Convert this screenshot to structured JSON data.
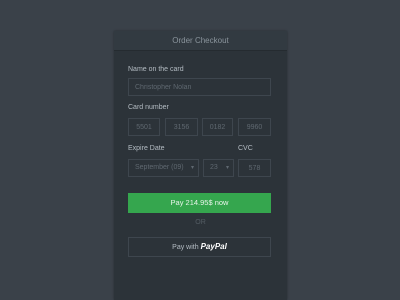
{
  "header": {
    "title": "Order Checkout"
  },
  "name_on_card": {
    "label": "Name on the card",
    "value": "Christopher Nolan"
  },
  "card_number": {
    "label": "Card number",
    "groups": [
      "5501",
      "3156",
      "0182",
      "9960"
    ]
  },
  "expire_date": {
    "label": "Expire Date",
    "month": "September (09)",
    "year": "23"
  },
  "cvc": {
    "label": "CVC",
    "value": "578"
  },
  "pay_button": {
    "label": "Pay 214.95$ now"
  },
  "separator": {
    "label": "OR"
  },
  "paypal_button": {
    "prefix": "Pay with",
    "brand": "PayPal"
  },
  "colors": {
    "accent": "#35a64e",
    "background": "#3a4149",
    "card": "#2c3339"
  }
}
